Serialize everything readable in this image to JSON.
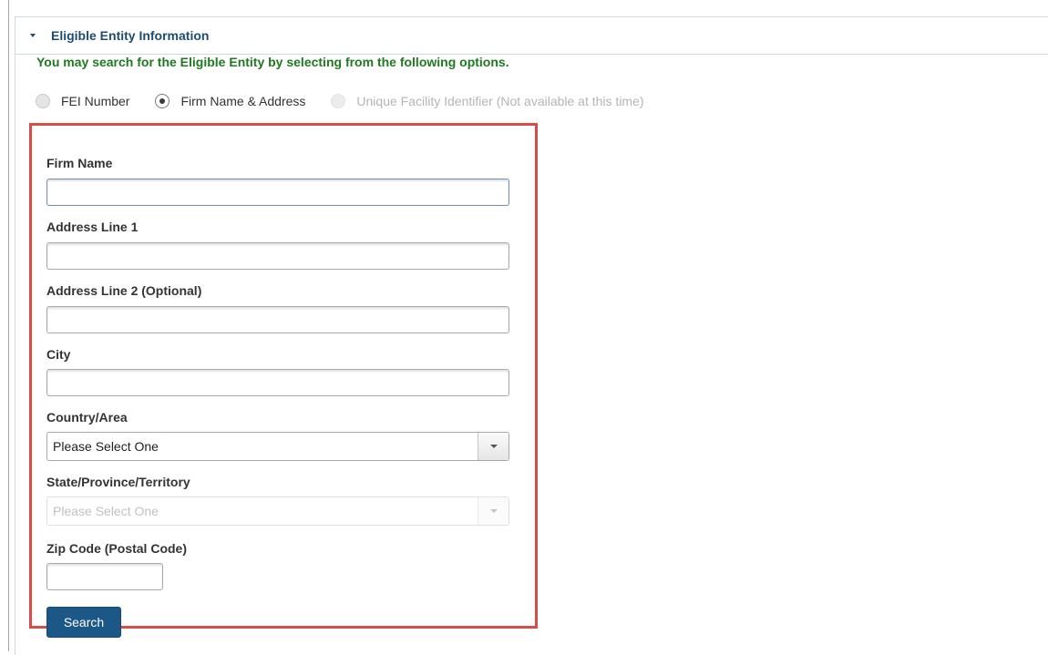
{
  "panel": {
    "title": "Eligible Entity Information",
    "instructions": "You may search for the Eligible Entity by selecting from the following options."
  },
  "search_options": [
    {
      "label": "FEI Number",
      "selected": false,
      "disabled": false
    },
    {
      "label": "Firm Name & Address",
      "selected": true,
      "disabled": false
    },
    {
      "label": "Unique Facility Identifier (Not available at this time)",
      "selected": false,
      "disabled": true
    }
  ],
  "form": {
    "firm_name": {
      "label": "Firm Name",
      "value": ""
    },
    "address_line_1": {
      "label": "Address Line 1",
      "value": ""
    },
    "address_line_2": {
      "label": "Address Line 2 (Optional)",
      "value": ""
    },
    "city": {
      "label": "City",
      "value": ""
    },
    "country": {
      "label": "Country/Area",
      "selected": "Please Select One"
    },
    "state": {
      "label": "State/Province/Territory",
      "selected": "Please Select One",
      "disabled": true
    },
    "zip": {
      "label": "Zip Code (Postal Code)",
      "value": ""
    },
    "search_label": "Search"
  },
  "colors": {
    "title": "#1f4b70",
    "instructions": "#1e7a1e",
    "highlight_border": "#d84b46",
    "button": "#1c5887"
  }
}
